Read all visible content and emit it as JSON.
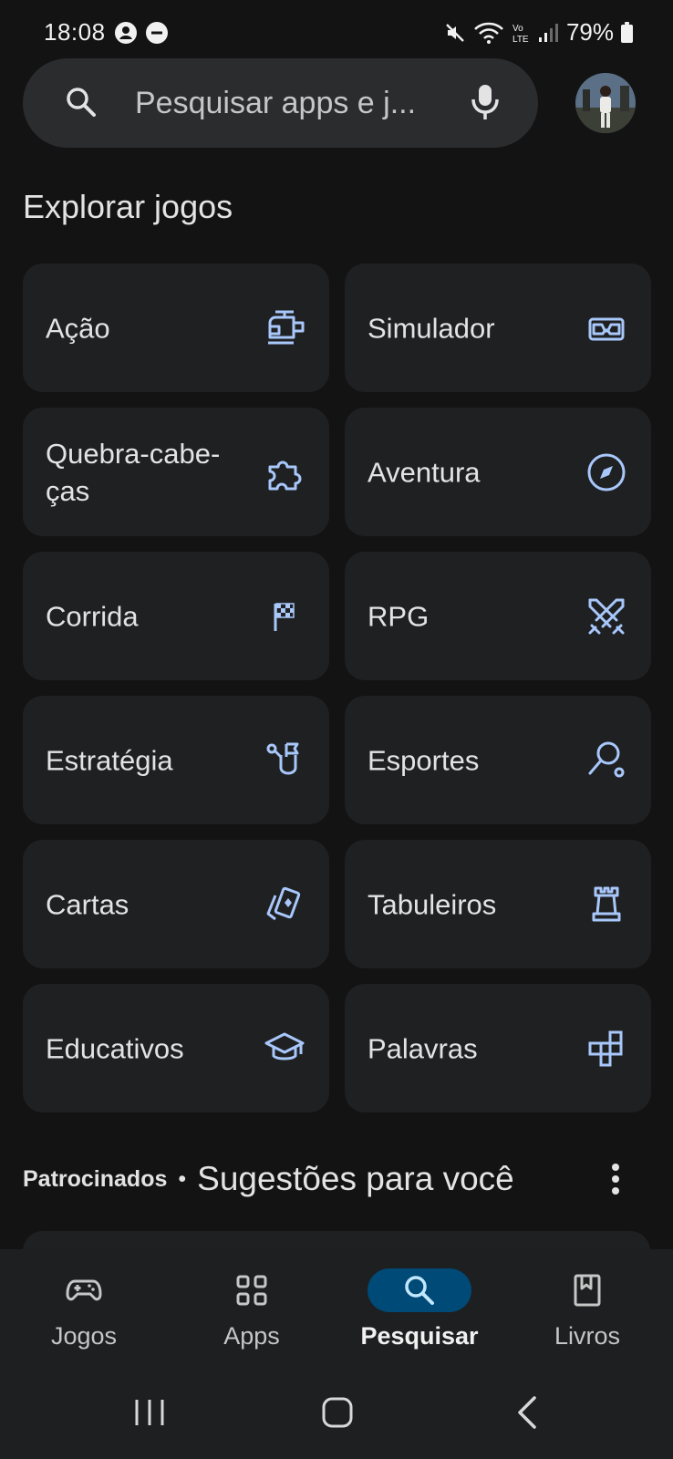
{
  "status_bar": {
    "time": "18:08",
    "battery": "79%",
    "icons": [
      "account-circle-icon",
      "do-not-disturb-icon",
      "mute-icon",
      "wifi-icon",
      "volte-icon",
      "signal-icon",
      "battery-icon"
    ]
  },
  "search": {
    "placeholder": "Pesquisar apps e j..."
  },
  "section_title": "Explorar jogos",
  "categories": [
    {
      "label": "Ação",
      "icon": "helicopter-icon"
    },
    {
      "label": "Simulador",
      "icon": "vr-headset-icon"
    },
    {
      "label": "Quebra-cabe-ças",
      "icon": "puzzle-icon"
    },
    {
      "label": "Aventura",
      "icon": "compass-icon"
    },
    {
      "label": "Corrida",
      "icon": "checkered-flag-icon"
    },
    {
      "label": "RPG",
      "icon": "crossed-swords-icon"
    },
    {
      "label": "Estratégia",
      "icon": "strategy-flag-icon"
    },
    {
      "label": "Esportes",
      "icon": "racket-ball-icon"
    },
    {
      "label": "Cartas",
      "icon": "playing-cards-icon"
    },
    {
      "label": "Tabuleiros",
      "icon": "chess-rook-icon"
    },
    {
      "label": "Educativos",
      "icon": "graduation-cap-icon"
    },
    {
      "label": "Palavras",
      "icon": "word-blocks-icon"
    }
  ],
  "sponsored": {
    "label": "Patrocinados",
    "separator": "•",
    "title": "Sugestões para você"
  },
  "bottom_nav": [
    {
      "label": "Jogos",
      "icon": "gamepad-icon",
      "active": false
    },
    {
      "label": "Apps",
      "icon": "apps-grid-icon",
      "active": false
    },
    {
      "label": "Pesquisar",
      "icon": "search-icon",
      "active": true
    },
    {
      "label": "Livros",
      "icon": "bookmark-book-icon",
      "active": false
    }
  ],
  "colors": {
    "background": "#131314",
    "tile": "#1f2022",
    "icon_accent": "#a8c7fa",
    "active_pill": "#004a77"
  }
}
